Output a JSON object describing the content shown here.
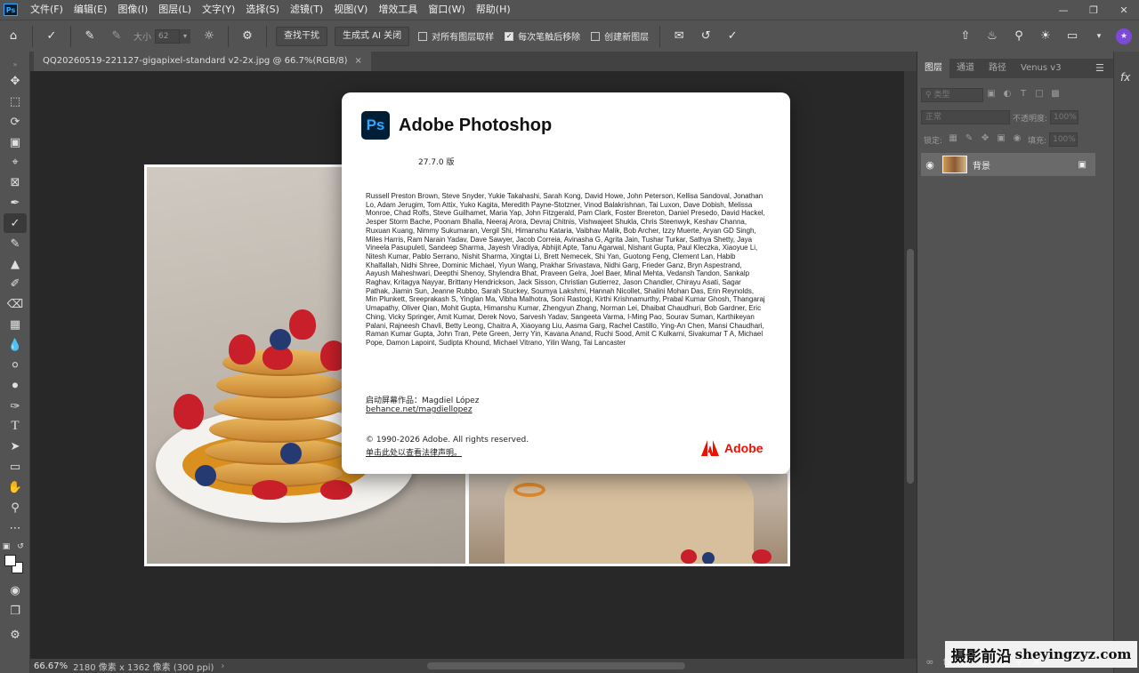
{
  "app": {
    "logo": "Ps"
  },
  "menu": [
    "文件(F)",
    "编辑(E)",
    "图像(I)",
    "图层(L)",
    "文字(Y)",
    "选择(S)",
    "滤镜(T)",
    "视图(V)",
    "增效工具",
    "窗口(W)",
    "帮助(H)"
  ],
  "options": {
    "size_label": "大小",
    "size_value": "62",
    "find_distraction": "查找干扰",
    "generative_ai": "生成式 AI 关闭",
    "sample_all_layers": "对所有图层取样",
    "remove_after_stroke": "每次笔触后移除",
    "create_new_layer": "创建新图层"
  },
  "document": {
    "tab_title": "QQ20260519-221127-gigapixel-standard v2-2x.jpg @ 66.7%(RGB/8)",
    "close_glyph": "×"
  },
  "status": {
    "zoom": "66.67%",
    "info": "2180 像素 x 1362 像素 (300 ppi)",
    "arrow": "›"
  },
  "panels": {
    "tabs": [
      "图层",
      "通道",
      "路径",
      "Venus v3"
    ],
    "filter_kind": "类型",
    "blend_mode": "正常",
    "opacity_label": "不透明度:",
    "opacity_value": "100%",
    "lock_label": "锁定:",
    "fill_label": "填充:",
    "fill_value": "100%",
    "layer_name": "背景"
  },
  "about": {
    "logo": "Ps",
    "title": "Adobe Photoshop",
    "version": "27.7.0 版",
    "credits": "Russell Preston Brown, Steve Snyder, Yukie Takahashi, Sarah Kong, David Howe, John Peterson, Kellisa Sandoval, Jonathan Lo, Adam Jerugim, Tom Attix, Yuko Kagita, Meredith Payne-Stotzner, Vinod Balakrishnan, Tai Luxon, Dave Dobish, Melissa Monroe, Chad Rolfs, Steve Guilhamet, Maria Yap, John Fitzgerald, Pam Clark, Foster Brereton, Daniel Presedo, David Hackel, Jesper Storm Bache, Poonam Bhalla, Neeraj Arora, Devraj Chitnis, Vishwajeet Shukla, Chris Steenwyk, Keshav Channa, Ruxuan Kuang, Nimmy Sukumaran, Vergil Shi, Himanshu Kataria, Vaibhav Malik, Bob Archer, Izzy Muerte, Aryan GD Singh, Miles Harris, Ram Narain Yadav, Dave Sawyer, Jacob Correia, Avinasha G, Agrita Jain, Tushar Turkar, Sathya Shetty, Jaya Vineela Pasupuleti, Sandeep Sharma, Jayesh Viradiya, Abhijit Apte, Tanu Agarwal, Nishant Gupta, Paul Kleczka, Xiaoyue Li, Nitesh Kumar, Pablo Serrano, Nishit Sharma, Xingtai Li, Brett Nemecek, Shi Yan, Guotong Feng, Clement Lan, Habib Khalfallah, Nidhi Shree, Dominic Michael, Yiyun Wang, Prakhar Srivastava, Nidhi Garg, Frieder Ganz, Bryn Aspestrand, Aayush Maheshwari, Deepthi Shenoy, Shylendra Bhat, Praveen Gelra, Joel Baer, Minal Mehta, Vedansh Tandon, Sankalp Raghav, Kritagya Nayyar, Brittany Hendrickson, Jack Sisson, Christian Gutierrez, Jason Chandler, Chirayu Asati, Sagar Pathak, Jiamin Sun, Jeanne Rubbo, Sarah Stuckey, Soumya Lakshmi, Hannah Nicollet, Shalini Mohan Das, Erin Reynolds, Min Plunkett, Sreeprakash S, Yinglan Ma, Vibha Malhotra, Soni Rastogi, Kirthi Krishnamurthy, Prabal Kumar Ghosh, Thangaraj Umapathy, Oliver Qian, Mohit Gupta, Himanshu Kumar, Zhengyun Zhang, Norman Lei, Dhaibat Chaudhuri, Bob Gardner, Eric Ching, Vicky Springer, Amit Kumar, Derek Novo, Sarvesh Yadav, Sangeeta Varma, I-Ming Pao, Sourav Suman, Karthikeyan Palani, Rajneesh Chavli, Betty Leong, Chaitra A, Xiaoyang Liu, Aasma Garg, Rachel Castillo, Ying-An Chen, Mansi Chaudhari, Raman Kumar Gupta, John Tran, Pete Green, Jerry Yin, Kavana Anand, Ruchi Sood, Amit C Kulkarni, Sivakumar T A, Michael Pope, Damon Lapoint, Sudipta Khound, Michael Vitrano, Yilin Wang, Tai Lancaster",
    "splash_label": "启动屏幕作品：Magdiel López",
    "splash_link": "behance.net/magdiellopez",
    "copyright": "© 1990-2026 Adobe. All rights reserved.",
    "legal_link": "单击此处以查看法律声明。",
    "adobe_wordmark": "Adobe",
    "adobe_red": "#eb1000"
  },
  "watermark": {
    "cn": "摄影前沿",
    "en": "sheyingzyz.com"
  }
}
